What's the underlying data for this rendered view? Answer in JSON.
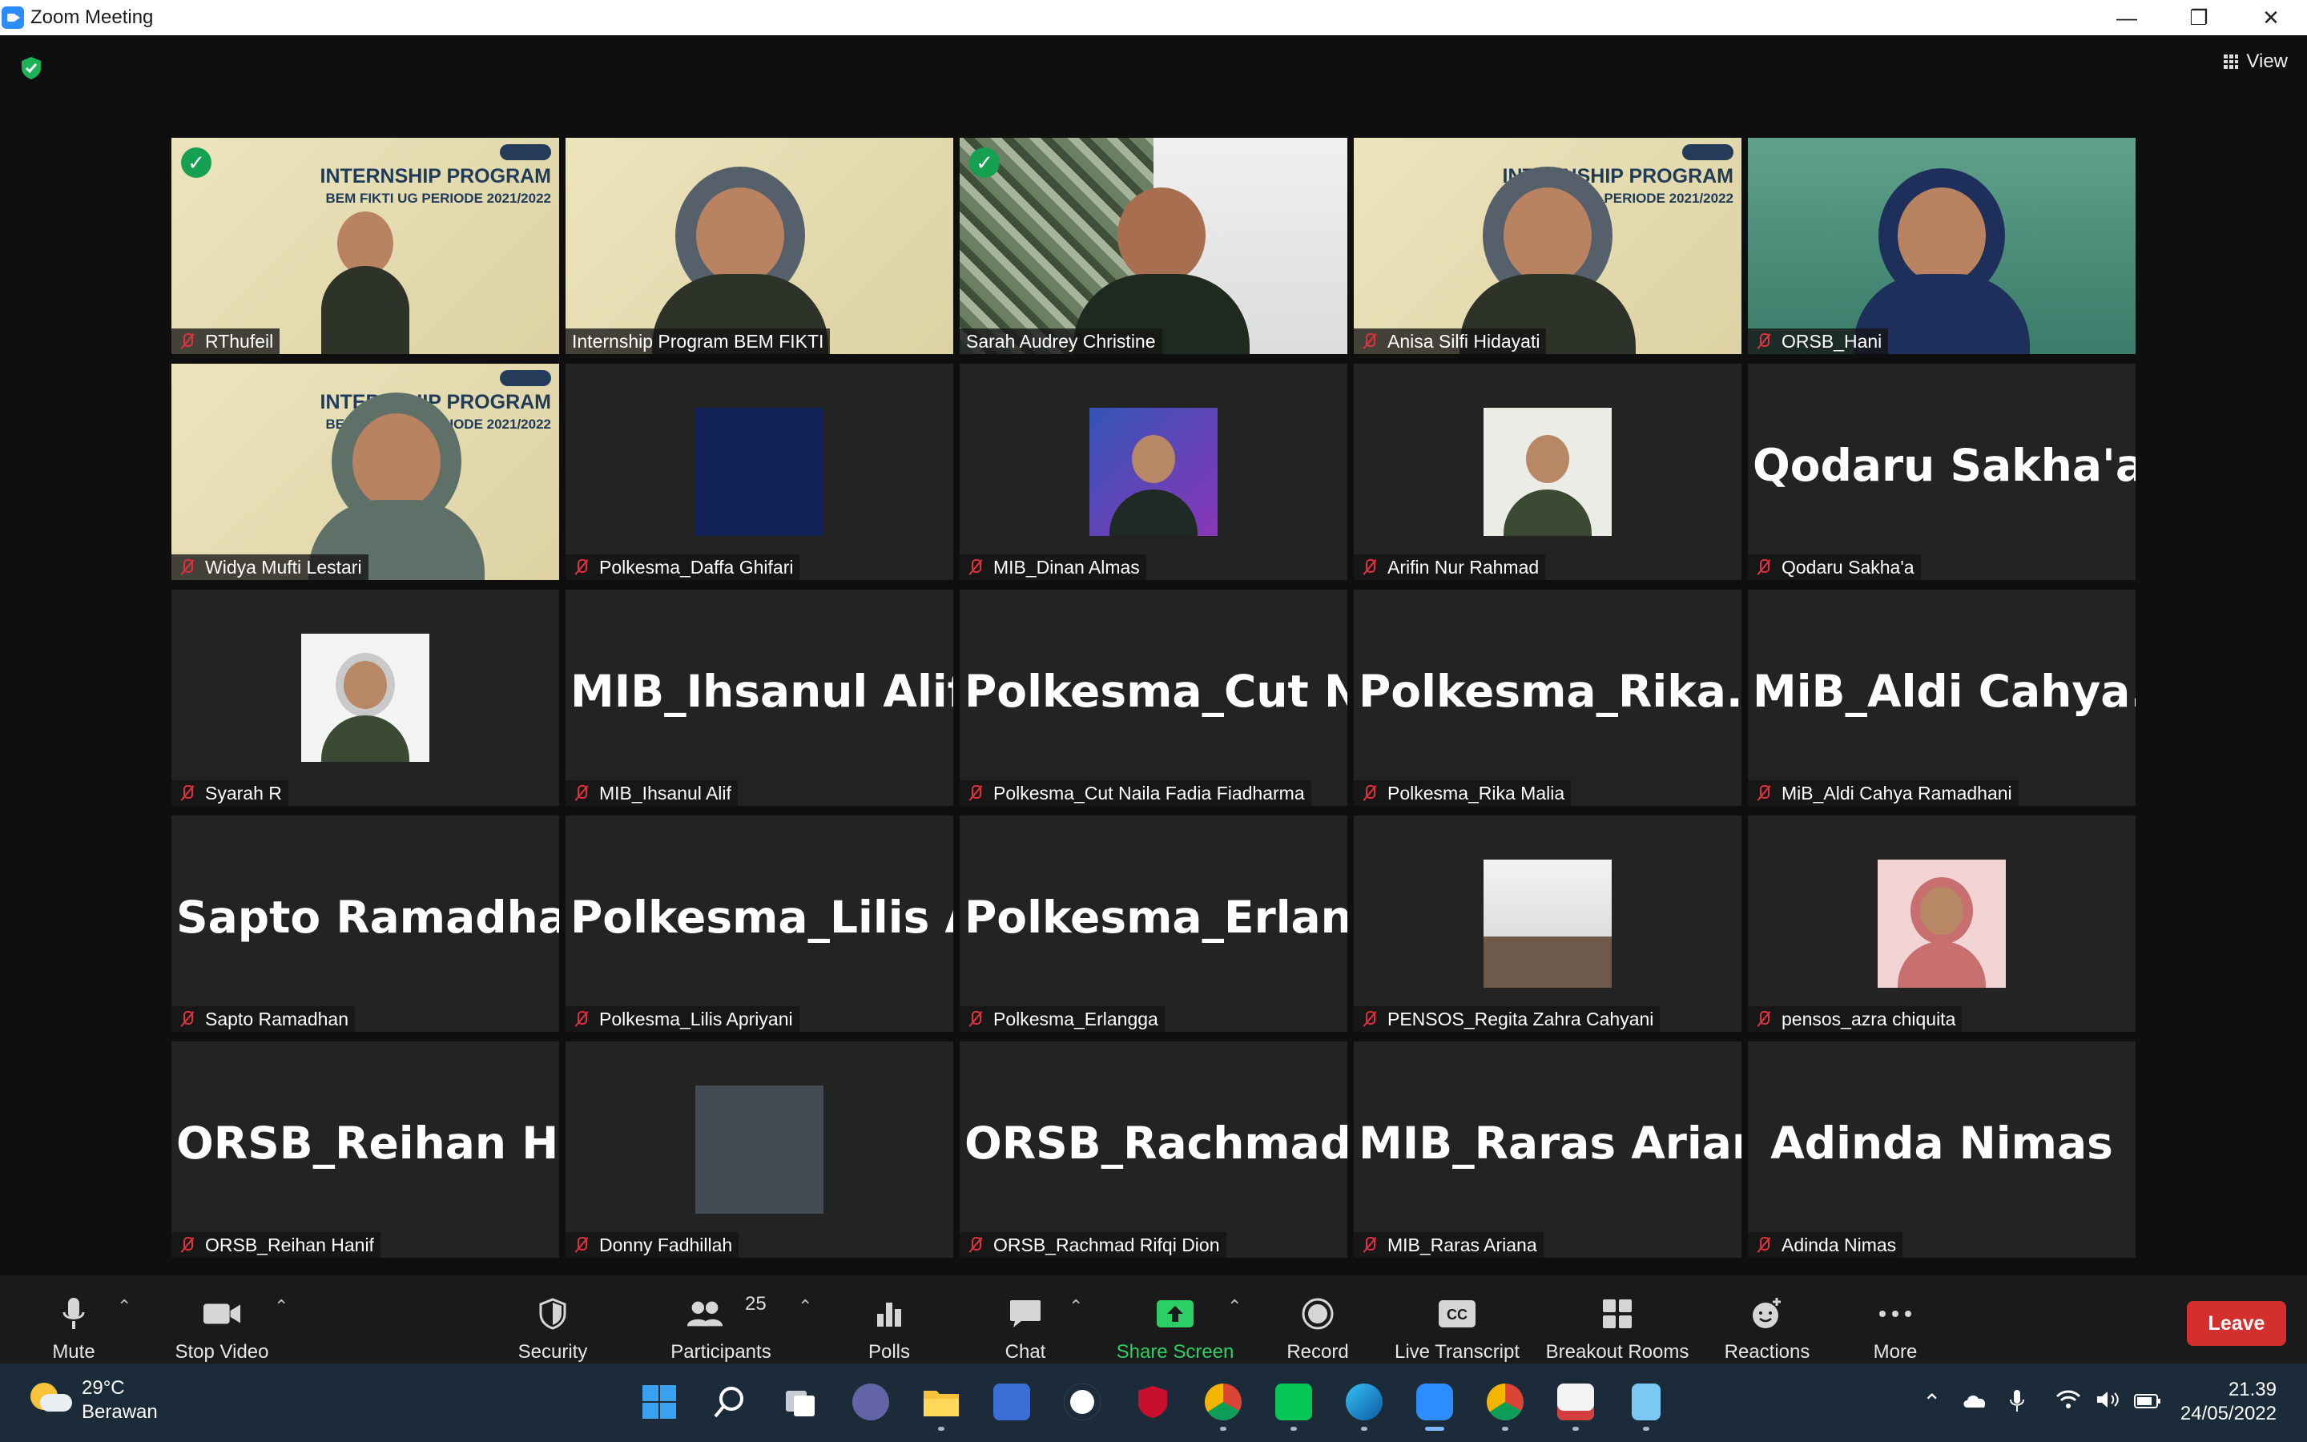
{
  "window": {
    "title": "Zoom Meeting",
    "controls": [
      "minimize-icon",
      "restore-icon",
      "close-icon"
    ]
  },
  "top": {
    "view_label": "View",
    "security_icon": "encryption-shield-icon"
  },
  "colors": {
    "speaking_border": "#dfe57a",
    "mic_muted": "#e0313e",
    "share_screen": "#2bcf65",
    "leave": "#d32f2f",
    "verified": "#15a052"
  },
  "tiles": [
    {
      "name": "RThufeil",
      "banner": "INTERNSHIP PROGRAM",
      "banner_sub": "BEM FIKTI UG PERIODE 2021/2022",
      "muted": true
    },
    {
      "name": "Internship Program BEM FIKTI",
      "muted": false
    },
    {
      "name": "Sarah Audrey Christine",
      "muted": false,
      "speaking": true
    },
    {
      "name": "Anisa Silfi Hidayati",
      "banner": "INTERNSHIP PROGRAM",
      "banner_sub": "BEM FIKTI UG PERIODE 2021/2022",
      "muted": true
    },
    {
      "name": "ORSB_Hani",
      "muted": true
    },
    {
      "name": "Widya Mufti Lestari",
      "banner": "INTERNSHIP PROGRAM",
      "banner_sub": "BEM FIKTI UG PERIODE 2021/2022",
      "muted": true
    },
    {
      "name": "Polkesma_Daffa Ghifari",
      "muted": true
    },
    {
      "name": "MIB_Dinan Almas",
      "muted": true
    },
    {
      "name": "Arifin Nur Rahmad",
      "muted": true
    },
    {
      "name": "Qodaru Sakha'a",
      "big": "Qodaru Sakha'a",
      "muted": true
    },
    {
      "name": "Syarah R",
      "muted": true
    },
    {
      "name": "MIB_Ihsanul Alif",
      "big": "MIB_Ihsanul Alif",
      "muted": true
    },
    {
      "name": "Polkesma_Cut Naila Fadia Fiadharma",
      "big": "Polkesma_Cut  N...",
      "muted": true
    },
    {
      "name": "Polkesma_Rika Malia",
      "big": "Polkesma_Rika...",
      "muted": true
    },
    {
      "name": "MiB_Aldi Cahya Ramadhani",
      "big": "MiB_Aldi  Cahya...",
      "muted": true
    },
    {
      "name": "Sapto Ramadhan",
      "big": "Sapto Ramadhan",
      "muted": true
    },
    {
      "name": "Polkesma_Lilis Apriyani",
      "big": "Polkesma_Lilis  A...",
      "muted": true
    },
    {
      "name": "Polkesma_Erlangga",
      "big": "Polkesma_Erlang...",
      "muted": true
    },
    {
      "name": "PENSOS_Regita Zahra Cahyani",
      "muted": true
    },
    {
      "name": "pensos_azra chiquita",
      "muted": true
    },
    {
      "name": "ORSB_Reihan Hanif",
      "big": "ORSB_Reihan  Ha...",
      "muted": true
    },
    {
      "name": "Donny Fadhillah",
      "muted": true
    },
    {
      "name": "ORSB_Rachmad Rifqi Dion",
      "big": "ORSB_Rachmad...",
      "muted": true
    },
    {
      "name": "MIB_Raras Ariana",
      "big": "MIB_Raras Ariana",
      "muted": true
    },
    {
      "name": "Adinda Nimas",
      "big": "Adinda Nimas",
      "muted": true
    }
  ],
  "toolbar": {
    "mute": "Mute",
    "stop_video": "Stop Video",
    "security": "Security",
    "participants": "Participants",
    "participant_count": "25",
    "polls": "Polls",
    "chat": "Chat",
    "share_screen": "Share Screen",
    "record": "Record",
    "live_transcript": "Live Transcript",
    "breakout_rooms": "Breakout Rooms",
    "reactions": "Reactions",
    "more": "More",
    "leave": "Leave"
  },
  "taskbar": {
    "temperature": "29°C",
    "weather": "Berawan",
    "time": "21.39",
    "date": "24/05/2022",
    "apps": [
      "windows-start-icon",
      "search-icon",
      "task-view-icon",
      "teams-chat-icon",
      "file-explorer-icon",
      "visual-studio-icon",
      "xbox-icon",
      "mcafee-icon",
      "chrome-icon",
      "line-icon",
      "edge-icon",
      "zoom-icon",
      "chrome-profile-icon",
      "snipping-tool-icon",
      "notepad-icon"
    ],
    "tray": [
      "chevron-up-icon",
      "onedrive-icon",
      "microphone-icon",
      "wifi-icon",
      "volume-icon",
      "battery-icon"
    ]
  }
}
